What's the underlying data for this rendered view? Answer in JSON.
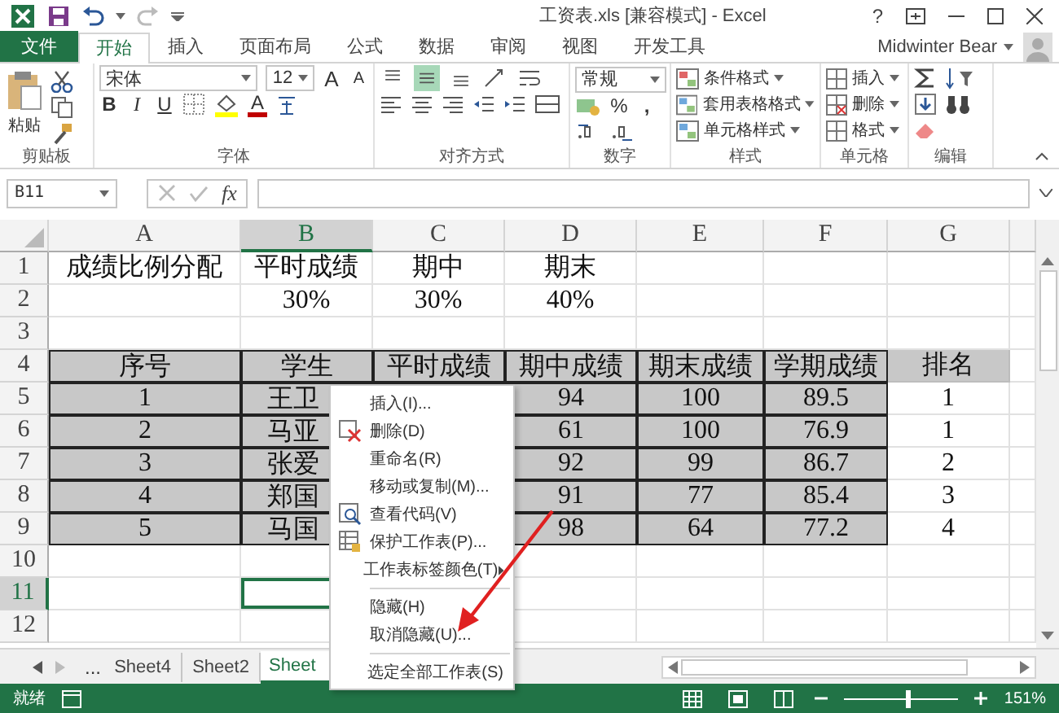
{
  "window": {
    "title": "工资表.xls  [兼容模式] - Excel",
    "help": "?"
  },
  "ribbon_tabs": [
    {
      "label": "文件",
      "kind": "file",
      "selected": false
    },
    {
      "label": "开始",
      "kind": "tab",
      "selected": true
    },
    {
      "label": "插入",
      "kind": "tab",
      "selected": false
    },
    {
      "label": "页面布局",
      "kind": "tab",
      "selected": false
    },
    {
      "label": "公式",
      "kind": "tab",
      "selected": false
    },
    {
      "label": "数据",
      "kind": "tab",
      "selected": false
    },
    {
      "label": "审阅",
      "kind": "tab",
      "selected": false
    },
    {
      "label": "视图",
      "kind": "tab",
      "selected": false
    },
    {
      "label": "开发工具",
      "kind": "tab",
      "selected": false
    }
  ],
  "user": {
    "name": "Midwinter Bear"
  },
  "ribbon": {
    "clipboard": {
      "paste": "粘贴",
      "label": "剪贴板"
    },
    "font": {
      "name": "宋体",
      "size": "12",
      "grow": "A",
      "shrink": "A",
      "bold": "B",
      "italic": "I",
      "underline": "U",
      "color_letter": "A",
      "label": "字体"
    },
    "alignment": {
      "vertical": [
        {
          "selected": false
        },
        {
          "selected": true
        },
        {
          "selected": false
        }
      ],
      "label": "对齐方式"
    },
    "number": {
      "format": "常规",
      "percent": "%",
      "comma": ",",
      "label": "数字"
    },
    "styles": {
      "items": [
        "条件格式",
        "套用表格格式",
        "单元格样式"
      ],
      "label": "样式"
    },
    "cells": {
      "items": [
        "插入",
        "删除",
        "格式"
      ],
      "label": "单元格"
    },
    "editing": {
      "label": "编辑"
    }
  },
  "formula_bar": {
    "name_box": "B11",
    "fx": "fx"
  },
  "sheet": {
    "columns": [
      {
        "label": "A",
        "selected": false
      },
      {
        "label": "B",
        "selected": true
      },
      {
        "label": "C",
        "selected": false
      },
      {
        "label": "D",
        "selected": false
      },
      {
        "label": "E",
        "selected": false
      },
      {
        "label": "F",
        "selected": false
      },
      {
        "label": "G",
        "selected": false
      }
    ],
    "rows": [
      {
        "label": "1",
        "selected": false,
        "cells": [
          {
            "text": "成绩比例分配",
            "kind": "plain"
          },
          {
            "text": "平时成绩",
            "kind": "plain"
          },
          {
            "text": "期中",
            "kind": "plain"
          },
          {
            "text": "期末",
            "kind": "plain"
          },
          {
            "kind": "plain"
          },
          {
            "kind": "plain"
          },
          {
            "kind": "plain"
          }
        ]
      },
      {
        "label": "2",
        "selected": false,
        "cells": [
          {
            "kind": "plain"
          },
          {
            "text": "30%",
            "kind": "plain"
          },
          {
            "text": "30%",
            "kind": "plain"
          },
          {
            "text": "40%",
            "kind": "plain"
          },
          {
            "kind": "plain"
          },
          {
            "kind": "plain"
          },
          {
            "kind": "plain"
          }
        ]
      },
      {
        "label": "3",
        "selected": false,
        "cells": [
          {
            "kind": "plain"
          },
          {
            "kind": "plain"
          },
          {
            "kind": "plain"
          },
          {
            "kind": "plain"
          },
          {
            "kind": "plain"
          },
          {
            "kind": "plain"
          },
          {
            "kind": "plain"
          }
        ]
      },
      {
        "label": "4",
        "selected": false,
        "cells": [
          {
            "text": "序号",
            "kind": "table"
          },
          {
            "text": "学生",
            "kind": "table"
          },
          {
            "text": "平时成绩",
            "kind": "table"
          },
          {
            "text": "期中成绩",
            "kind": "table"
          },
          {
            "text": "期末成绩",
            "kind": "table"
          },
          {
            "text": "学期成绩",
            "kind": "table"
          },
          {
            "text": "排名",
            "kind": "shaded"
          }
        ]
      },
      {
        "label": "5",
        "selected": false,
        "cells": [
          {
            "text": "1",
            "kind": "table"
          },
          {
            "text": "王卫",
            "kind": "name"
          },
          {
            "kind": "table"
          },
          {
            "text": "94",
            "kind": "table"
          },
          {
            "text": "100",
            "kind": "table"
          },
          {
            "text": "89.5",
            "kind": "table"
          },
          {
            "text": "1",
            "kind": "plain"
          }
        ]
      },
      {
        "label": "6",
        "selected": false,
        "cells": [
          {
            "text": "2",
            "kind": "table"
          },
          {
            "text": "马亚",
            "kind": "name"
          },
          {
            "kind": "table"
          },
          {
            "text": "61",
            "kind": "table"
          },
          {
            "text": "100",
            "kind": "table"
          },
          {
            "text": "76.9",
            "kind": "table"
          },
          {
            "text": "1",
            "kind": "plain"
          }
        ]
      },
      {
        "label": "7",
        "selected": false,
        "cells": [
          {
            "text": "3",
            "kind": "table"
          },
          {
            "text": "张爱",
            "kind": "name"
          },
          {
            "kind": "table"
          },
          {
            "text": "92",
            "kind": "table"
          },
          {
            "text": "99",
            "kind": "table"
          },
          {
            "text": "86.7",
            "kind": "table"
          },
          {
            "text": "2",
            "kind": "plain"
          }
        ]
      },
      {
        "label": "8",
        "selected": false,
        "cells": [
          {
            "text": "4",
            "kind": "table"
          },
          {
            "text": "郑国",
            "kind": "name"
          },
          {
            "kind": "table"
          },
          {
            "text": "91",
            "kind": "table"
          },
          {
            "text": "77",
            "kind": "table"
          },
          {
            "text": "85.4",
            "kind": "table"
          },
          {
            "text": "3",
            "kind": "plain"
          }
        ]
      },
      {
        "label": "9",
        "selected": false,
        "cells": [
          {
            "text": "5",
            "kind": "table"
          },
          {
            "text": "马国",
            "kind": "name"
          },
          {
            "kind": "table"
          },
          {
            "text": "98",
            "kind": "table"
          },
          {
            "text": "64",
            "kind": "table"
          },
          {
            "text": "77.2",
            "kind": "table"
          },
          {
            "text": "4",
            "kind": "plain"
          }
        ]
      },
      {
        "label": "10",
        "selected": false,
        "cells": [
          {
            "kind": "plain"
          },
          {
            "kind": "plain"
          },
          {
            "kind": "plain"
          },
          {
            "kind": "plain"
          },
          {
            "kind": "plain"
          },
          {
            "kind": "plain"
          },
          {
            "kind": "plain"
          }
        ]
      },
      {
        "label": "11",
        "selected": true,
        "cells": [
          {
            "kind": "plain"
          },
          {
            "kind": "plain"
          },
          {
            "kind": "plain"
          },
          {
            "kind": "plain"
          },
          {
            "kind": "plain"
          },
          {
            "kind": "plain"
          },
          {
            "kind": "plain"
          }
        ]
      },
      {
        "label": "12",
        "selected": false,
        "cells": [
          {
            "kind": "plain"
          },
          {
            "kind": "plain"
          },
          {
            "kind": "plain"
          },
          {
            "kind": "plain"
          },
          {
            "kind": "plain"
          },
          {
            "kind": "plain"
          },
          {
            "kind": "plain"
          }
        ]
      }
    ]
  },
  "context_menu": {
    "items": [
      {
        "label": "插入(I)...",
        "kind": "item",
        "divider_after": false
      },
      {
        "label": "删除(D)",
        "kind": "item",
        "divider_after": false
      },
      {
        "label": "重命名(R)",
        "kind": "item",
        "divider_after": false
      },
      {
        "label": "移动或复制(M)...",
        "kind": "item",
        "divider_after": false
      },
      {
        "label": "查看代码(V)",
        "kind": "item",
        "divider_after": false
      },
      {
        "label": "保护工作表(P)...",
        "kind": "item",
        "divider_after": false
      },
      {
        "label": "工作表标签颜色(T)",
        "kind": "submenu",
        "divider_after": true
      },
      {
        "label": "隐藏(H)",
        "kind": "item",
        "divider_after": false
      },
      {
        "label": "取消隐藏(U)...",
        "kind": "item",
        "divider_after": true
      },
      {
        "label": "选定全部工作表(S)",
        "kind": "item",
        "divider_after": false
      }
    ]
  },
  "sheet_tabs": {
    "more": "...",
    "tabs": [
      {
        "label": "Sheet4",
        "selected": false
      },
      {
        "label": "Sheet2",
        "selected": false
      },
      {
        "label": "Sheet",
        "selected": true
      }
    ]
  },
  "status_bar": {
    "text": "就绪",
    "zoom": {
      "level": 0.55,
      "reading": "151%"
    }
  }
}
